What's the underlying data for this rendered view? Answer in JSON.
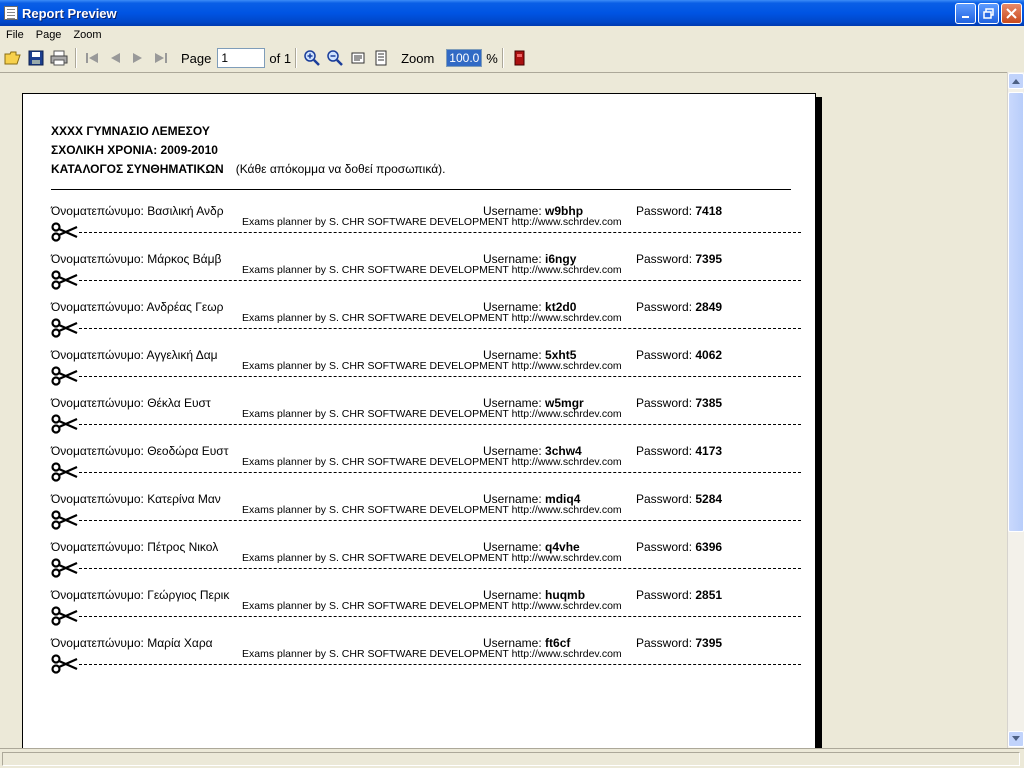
{
  "window": {
    "title": "Report Preview"
  },
  "menu": [
    "File",
    "Page",
    "Zoom"
  ],
  "toolbar": {
    "page_label": "Page",
    "page_value": "1",
    "of_label": "of 1",
    "zoom_label": "Zoom",
    "zoom_value": "100.0",
    "zoom_unit": "%"
  },
  "report": {
    "school": "XXXX ΓΥΜΝΑΣΙΟ ΛΕΜΕΣΟΥ",
    "year": "ΣΧΟΛΙΚΗ ΧΡΟΝΙΑ: 2009-2010",
    "catalog": "ΚΑΤΑΛΟΓΟΣ ΣΥΝΘΗΜΑΤΙΚΩΝ",
    "note": "(Κάθε απόκομμα να δοθεί προσωπικά).",
    "name_label": "Όνοματεπώνυμο:",
    "user_label": "Username:",
    "pass_label": "Password:",
    "credit": "Exams planner by S. CHR SOFTWARE DEVELOPMENT http://www.schrdev.com",
    "rows": [
      {
        "name": "Βασιλική Ανδρ",
        "username": "w9bhp",
        "password": "7418"
      },
      {
        "name": "Μάρκος Βάμβ",
        "username": "i6ngy",
        "password": "7395"
      },
      {
        "name": "Ανδρέας Γεωρ",
        "username": "kt2d0",
        "password": "2849"
      },
      {
        "name": "Αγγελική Δαμ",
        "username": "5xht5",
        "password": "4062"
      },
      {
        "name": "Θέκλα Ευστ",
        "username": "w5mgr",
        "password": "7385"
      },
      {
        "name": "Θεοδώρα Ευστ",
        "username": "3chw4",
        "password": "4173"
      },
      {
        "name": "Κατερίνα Μαν",
        "username": "mdiq4",
        "password": "5284"
      },
      {
        "name": "Πέτρος Νικολ",
        "username": "q4vhe",
        "password": "6396"
      },
      {
        "name": "Γεώργιος Περικ",
        "username": "huqmb",
        "password": "2851"
      },
      {
        "name": "Μαρία Χαρα",
        "username": "ft6cf",
        "password": "7395"
      }
    ]
  }
}
